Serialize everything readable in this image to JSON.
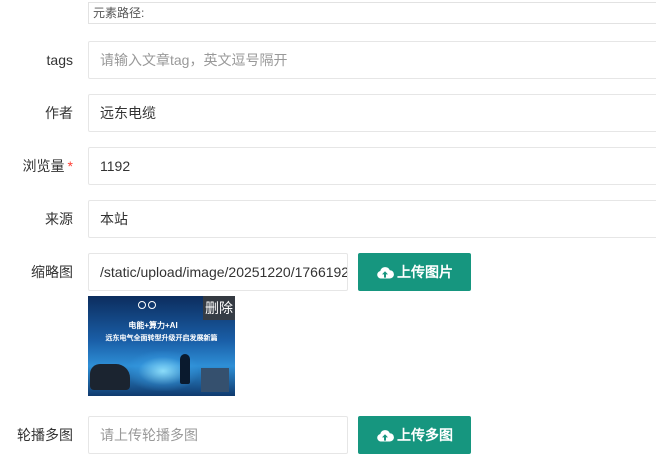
{
  "element_path": {
    "label": "元素路径:"
  },
  "fields": {
    "tags": {
      "label": "tags",
      "placeholder": "请输入文章tag，英文逗号隔开"
    },
    "author": {
      "label": "作者",
      "value": "远东电缆"
    },
    "views": {
      "label": "浏览量",
      "required_mark": "*",
      "value": "1192"
    },
    "source": {
      "label": "来源",
      "value": "本站"
    },
    "thumbnail": {
      "label": "缩略图",
      "value": "/static/upload/image/20251220/1766192",
      "upload_button": "上传图片",
      "delete_label": "删除",
      "preview_title_1": "电能+算力+AI",
      "preview_title_2": "远东电气全面转型升级开启发展新篇"
    },
    "carousel": {
      "label": "轮播多图",
      "placeholder": "请上传轮播多图",
      "upload_button": "上传多图"
    }
  },
  "colors": {
    "primary": "#16967f",
    "required": "#ff3b30",
    "border": "#e6e6e6"
  },
  "icons": {
    "upload": "cloud-upload-icon"
  }
}
